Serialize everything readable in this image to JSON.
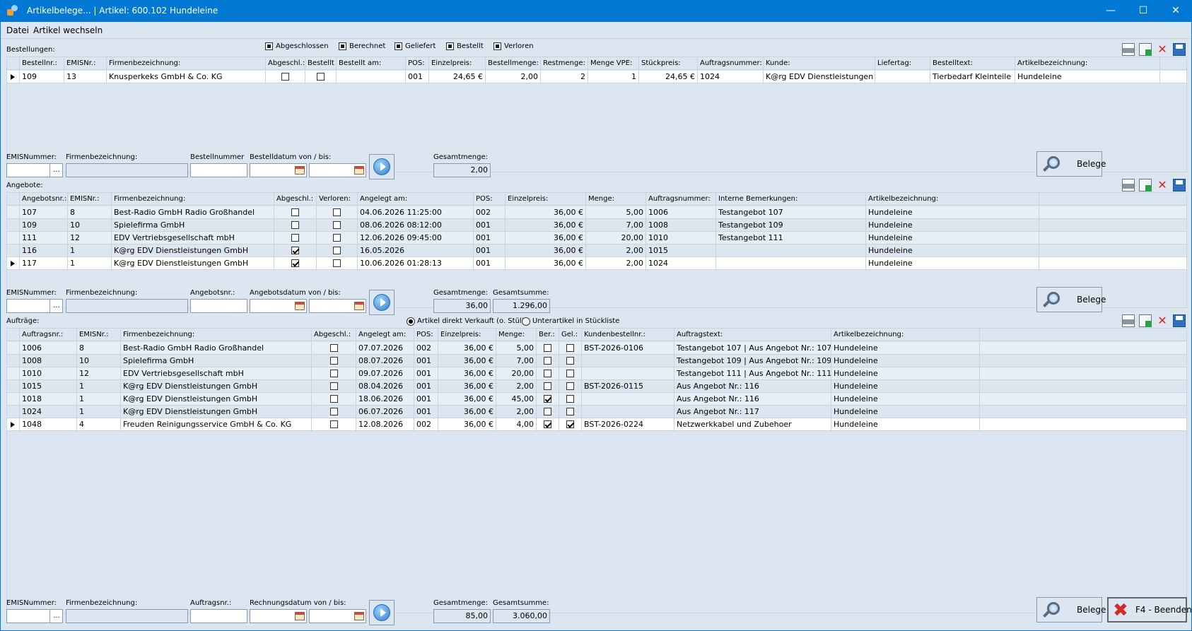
{
  "window": {
    "title": "Artikelbelege... | Artikel: 600.102 Hundeleine",
    "minimize": "—",
    "maximize": "☐",
    "close": "✕"
  },
  "menu": [
    "Datei",
    "Artikel wechseln"
  ],
  "bestellungen": {
    "label": "Bestellungen:",
    "filters": [
      "Abgeschlossen",
      "Berechnet",
      "Geliefert",
      "Bestellt",
      "Verloren"
    ],
    "columns": [
      "Bestellnr.:",
      "EMISNr.:",
      "Firmenbezeichnung:",
      "Abgeschl.:",
      "Bestellt",
      "Bestellt am:",
      "POS:",
      "Einzelpreis:",
      "Bestellmenge:",
      "Restmenge:",
      "Menge VPE:",
      "Stückpreis:",
      "Auftragsnummer:",
      "Kunde:",
      "Liefertag:",
      "Bestelltext:",
      "Artikelbezeichnung:"
    ],
    "rows": [
      {
        "nr": "109",
        "emis": "13",
        "firma": "Knusperkeks GmbH & Co. KG",
        "abgeschl": false,
        "bestellt": false,
        "bestellt_am": "",
        "pos": "001",
        "einzelpreis": "24,65 €",
        "bestellmenge": "2,00",
        "restmenge": "2",
        "vpe": "1",
        "stueckpreis": "24,65 €",
        "auftrag": "1024",
        "kunde": "K@rg EDV Dienstleistungen",
        "liefertag": "",
        "bestelltext": "Tierbedarf Kleinteile",
        "artikel": "Hundeleine"
      }
    ],
    "filter_form": {
      "emis_label": "EMISNummer:",
      "firma_label": "Firmenbezeichnung:",
      "nr_label": "Bestellnummer",
      "datum_label": "Bestelldatum von / bis:",
      "gesamtmenge_label": "Gesamtmenge:",
      "gesamtmenge": "2,00",
      "belege": "Belege",
      "dots": "..."
    }
  },
  "angebote": {
    "label": "Angebote:",
    "columns": [
      "Angebotsnr.:",
      "EMISNr.:",
      "Firmenbezeichnung:",
      "Abgeschl.:",
      "Verloren:",
      "Angelegt am:",
      "POS:",
      "Einzelpreis:",
      "Menge:",
      "Auftragsnummer:",
      "Interne Bemerkungen:",
      "Artikelbezeichnung:"
    ],
    "rows": [
      {
        "nr": "107",
        "emis": "8",
        "firma": "Best-Radio GmbH Radio Großhandel",
        "abgeschl": false,
        "verloren": false,
        "angelegt": "04.06.2026 11:25:00",
        "pos": "002",
        "einzelpreis": "36,00 €",
        "menge": "5,00",
        "auftrag": "1006",
        "bemerkung": "Testangebot 107",
        "artikel": "Hundeleine"
      },
      {
        "nr": "109",
        "emis": "10",
        "firma": "Spielefirma GmbH",
        "abgeschl": false,
        "verloren": false,
        "angelegt": "08.06.2026 08:12:00",
        "pos": "001",
        "einzelpreis": "36,00 €",
        "menge": "7,00",
        "auftrag": "1008",
        "bemerkung": "Testangebot 109",
        "artikel": "Hundeleine"
      },
      {
        "nr": "111",
        "emis": "12",
        "firma": "EDV Vertriebsgesellschaft mbH",
        "abgeschl": false,
        "verloren": false,
        "angelegt": "12.06.2026 09:45:00",
        "pos": "001",
        "einzelpreis": "36,00 €",
        "menge": "20,00",
        "auftrag": "1010",
        "bemerkung": "Testangebot 111",
        "artikel": "Hundeleine"
      },
      {
        "nr": "116",
        "emis": "1",
        "firma": "K@rg EDV Dienstleistungen GmbH",
        "abgeschl": true,
        "verloren": false,
        "angelegt": "16.05.2026",
        "pos": "001",
        "einzelpreis": "36,00 €",
        "menge": "2,00",
        "auftrag": "1015",
        "bemerkung": "",
        "artikel": "Hundeleine"
      },
      {
        "nr": "117",
        "emis": "1",
        "firma": "K@rg EDV Dienstleistungen GmbH",
        "abgeschl": true,
        "verloren": false,
        "angelegt": "10.06.2026 01:28:13",
        "pos": "001",
        "einzelpreis": "36,00 €",
        "menge": "2,00",
        "auftrag": "1024",
        "bemerkung": "",
        "artikel": "Hundeleine"
      }
    ],
    "filter_form": {
      "emis_label": "EMISNummer:",
      "firma_label": "Firmenbezeichnung:",
      "nr_label": "Angebotsnr.:",
      "datum_label": "Angebotsdatum von / bis:",
      "gesamtmenge_label": "Gesamtmenge:",
      "gesamtmenge": "36,00",
      "gesamtsumme_label": "Gesamtsumme:",
      "gesamtsumme": "1.296,00",
      "belege": "Belege",
      "dots": "..."
    }
  },
  "auftraege": {
    "label": "Aufträge:",
    "radio1": "Artikel direkt Verkauft (o. Stüli)",
    "radio2": "Unterartikel in Stückliste",
    "columns": [
      "Auftragsnr.:",
      "EMISNr.:",
      "Firmenbezeichnung:",
      "Abgeschl.:",
      "Angelegt am:",
      "POS:",
      "Einzelpreis:",
      "Menge:",
      "Ber.:",
      "Gel.:",
      "Kundenbestellnr.:",
      "Auftragstext:",
      "Artikelbezeichnung:"
    ],
    "rows": [
      {
        "nr": "1006",
        "emis": "8",
        "firma": "Best-Radio GmbH Radio Großhandel",
        "abgeschl": false,
        "angelegt": "07.07.2026",
        "pos": "002",
        "einzelpreis": "36,00 €",
        "menge": "5,00",
        "ber": false,
        "gel": false,
        "kbnr": "BST-2026-0106",
        "text": "Testangebot 107 | Aus Angebot Nr.: 107",
        "artikel": "Hundeleine"
      },
      {
        "nr": "1008",
        "emis": "10",
        "firma": "Spielefirma GmbH",
        "abgeschl": false,
        "angelegt": "08.07.2026",
        "pos": "001",
        "einzelpreis": "36,00 €",
        "menge": "7,00",
        "ber": false,
        "gel": false,
        "kbnr": "",
        "text": "Testangebot 109 | Aus Angebot Nr.: 109",
        "artikel": "Hundeleine"
      },
      {
        "nr": "1010",
        "emis": "12",
        "firma": "EDV Vertriebsgesellschaft mbH",
        "abgeschl": false,
        "angelegt": "09.07.2026",
        "pos": "001",
        "einzelpreis": "36,00 €",
        "menge": "20,00",
        "ber": false,
        "gel": false,
        "kbnr": "",
        "text": "Testangebot 111 | Aus Angebot Nr.: 111",
        "artikel": "Hundeleine"
      },
      {
        "nr": "1015",
        "emis": "1",
        "firma": "K@rg EDV Dienstleistungen GmbH",
        "abgeschl": false,
        "angelegt": "08.04.2026",
        "pos": "001",
        "einzelpreis": "36,00 €",
        "menge": "2,00",
        "ber": false,
        "gel": false,
        "kbnr": "BST-2026-0115",
        "text": "Aus Angebot Nr.: 116",
        "artikel": "Hundeleine"
      },
      {
        "nr": "1018",
        "emis": "1",
        "firma": "K@rg EDV Dienstleistungen GmbH",
        "abgeschl": false,
        "angelegt": "18.06.2026",
        "pos": "001",
        "einzelpreis": "36,00 €",
        "menge": "45,00",
        "ber": true,
        "gel": false,
        "kbnr": "",
        "text": "Aus Angebot Nr.: 116",
        "artikel": "Hundeleine"
      },
      {
        "nr": "1024",
        "emis": "1",
        "firma": "K@rg EDV Dienstleistungen GmbH",
        "abgeschl": false,
        "angelegt": "06.07.2026",
        "pos": "001",
        "einzelpreis": "36,00 €",
        "menge": "2,00",
        "ber": false,
        "gel": false,
        "kbnr": "",
        "text": "Aus Angebot Nr.: 117",
        "artikel": "Hundeleine"
      },
      {
        "nr": "1048",
        "emis": "4",
        "firma": "Freuden Reinigungsservice GmbH & Co. KG",
        "abgeschl": false,
        "angelegt": "12.08.2026",
        "pos": "002",
        "einzelpreis": "36,00 €",
        "menge": "4,00",
        "ber": true,
        "gel": true,
        "kbnr": "BST-2026-0224",
        "text": "Netzwerkkabel und Zubehoer",
        "artikel": "Hundeleine"
      }
    ],
    "filter_form": {
      "emis_label": "EMISNummer:",
      "firma_label": "Firmenbezeichnung:",
      "nr_label": "Auftragsnr.:",
      "datum_label": "Rechnungsdatum von / bis:",
      "gesamtmenge_label": "Gesamtmenge:",
      "gesamtmenge": "85,00",
      "gesamtsumme_label": "Gesamtsumme:",
      "gesamtsumme": "3.060,00",
      "belege": "Belege",
      "dots": "...",
      "beenden": "F4 - Beenden"
    }
  }
}
